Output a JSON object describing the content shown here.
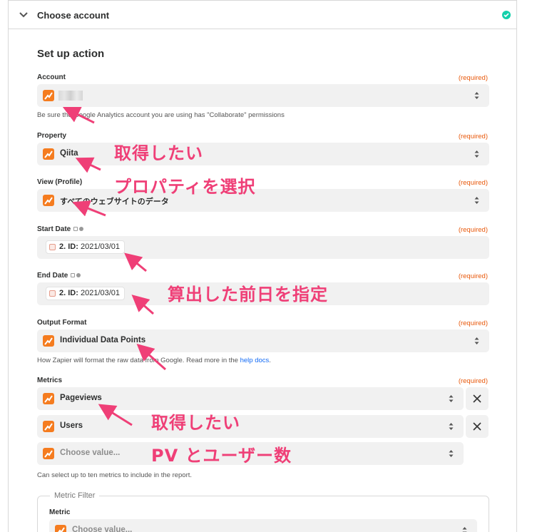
{
  "header": {
    "title": "Choose account",
    "status": "complete"
  },
  "section_title": "Set up action",
  "required_text": "(required)",
  "account": {
    "label": "Account",
    "help": "Be sure the Google Analytics account you are using has \"Collaborate\" permissions"
  },
  "property": {
    "label": "Property",
    "value": "Qiita"
  },
  "view": {
    "label": "View (Profile)",
    "value": "すべてのウェブサイトのデータ"
  },
  "start_date": {
    "label": "Start Date",
    "pill_prefix": "2. ID:",
    "pill_value": "2021/03/01"
  },
  "end_date": {
    "label": "End Date",
    "pill_prefix": "2. ID:",
    "pill_value": "2021/03/01"
  },
  "output_format": {
    "label": "Output Format",
    "value": "Individual Data Points",
    "help_prefix": "How Zapier will format the raw data from Google. Read more in the ",
    "help_link": "help docs",
    "help_suffix": "."
  },
  "metrics": {
    "label": "Metrics",
    "items": [
      "Pageviews",
      "Users"
    ],
    "placeholder": "Choose value...",
    "help": "Can select up to ten metrics to include in the report."
  },
  "metric_filter": {
    "legend": "Metric Filter",
    "label": "Metric",
    "placeholder": "Choose value..."
  },
  "annotations": {
    "a1": "取得したい",
    "a2": "プロパティを選択",
    "a3": "算出した前日を指定",
    "a4": "取得したい",
    "a5": "PV とユーザー数"
  },
  "colors": {
    "accent": "#ef3f77",
    "required": "#e8590c",
    "check": "#13d0ab",
    "ga": "#f57c1f"
  }
}
